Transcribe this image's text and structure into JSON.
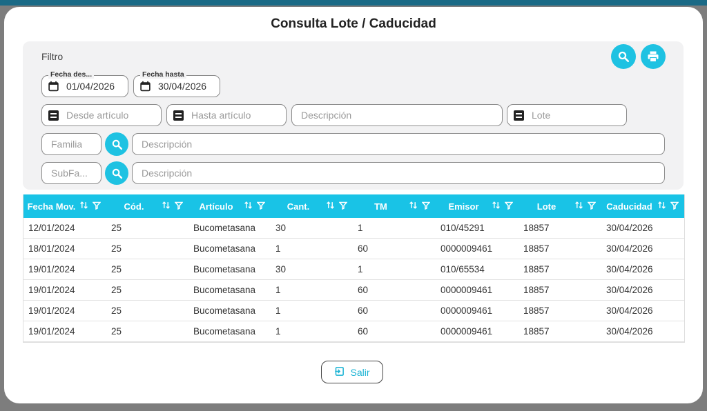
{
  "modal": {
    "title": "Consulta Lote / Caducidad"
  },
  "filter": {
    "label": "Filtro",
    "search_icon": "search-icon",
    "print_icon": "print-icon",
    "fecha_desde": {
      "legend": "Fecha des...",
      "value": "01/04/2026"
    },
    "fecha_hasta": {
      "legend": "Fecha hasta",
      "value": "30/04/2026"
    },
    "desde_articulo": {
      "placeholder": "Desde artículo"
    },
    "hasta_articulo": {
      "placeholder": "Hasta artículo"
    },
    "descripcion_articulo": {
      "placeholder": "Descripción"
    },
    "lote": {
      "placeholder": "Lote"
    },
    "familia": {
      "placeholder": "Familia"
    },
    "familia_descripcion": {
      "placeholder": "Descripción"
    },
    "subfamilia": {
      "placeholder": "SubFa..."
    },
    "subfamilia_descripcion": {
      "placeholder": "Descripción"
    }
  },
  "table": {
    "columns": [
      "Fecha Mov.",
      "Cód.",
      "Artículo",
      "Cant.",
      "TM",
      "Emisor",
      "Lote",
      "Caducidad"
    ],
    "rows": [
      [
        "12/01/2024",
        "25",
        "Bucometasana",
        "30",
        "1",
        "010/45291",
        "18857",
        "30/04/2026"
      ],
      [
        "18/01/2024",
        "25",
        "Bucometasana",
        "1",
        "60",
        "0000009461",
        "18857",
        "30/04/2026"
      ],
      [
        "19/01/2024",
        "25",
        "Bucometasana",
        "30",
        "1",
        "010/65534",
        "18857",
        "30/04/2026"
      ],
      [
        "19/01/2024",
        "25",
        "Bucometasana",
        "1",
        "60",
        "0000009461",
        "18857",
        "30/04/2026"
      ],
      [
        "19/01/2024",
        "25",
        "Bucometasana",
        "1",
        "60",
        "0000009461",
        "18857",
        "30/04/2026"
      ],
      [
        "19/01/2024",
        "25",
        "Bucometasana",
        "1",
        "60",
        "0000009461",
        "18857",
        "30/04/2026"
      ]
    ]
  },
  "footer": {
    "salir_label": "Salir",
    "exit_icon": "exit-icon"
  },
  "colors": {
    "accent": "#1ec2e2",
    "header": "#19c3e6"
  }
}
